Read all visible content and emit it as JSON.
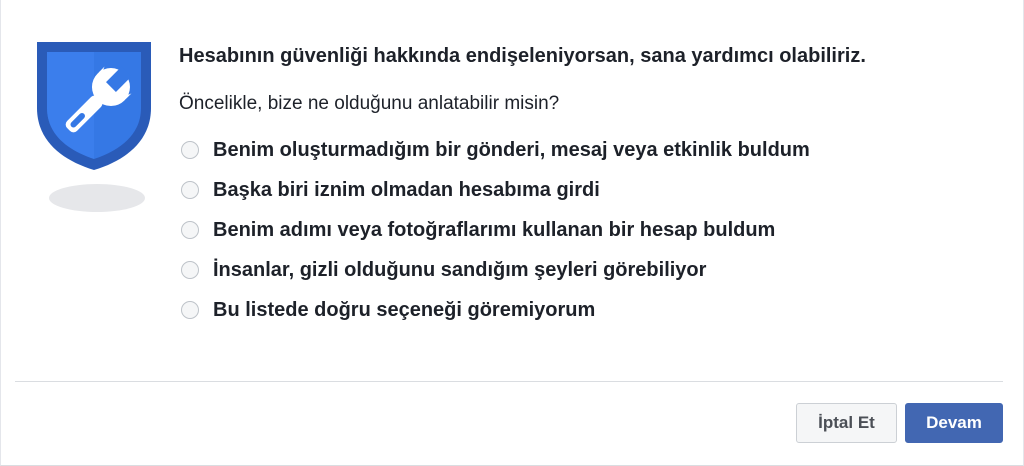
{
  "illustration": {
    "icon": "shield-wrench-icon",
    "shield_color": "#3578e5",
    "shield_border_color": "#2a5bb8"
  },
  "dialog": {
    "headline": "Hesabının güvenliği hakkında endişeleniyorsan, sana yardımcı olabiliriz.",
    "question": "Öncelikle, bize ne olduğunu anlatabilir misin?",
    "options": [
      {
        "label": "Benim oluşturmadığım bir gönderi, mesaj veya etkinlik buldum",
        "selected": false
      },
      {
        "label": "Başka biri iznim olmadan hesabıma girdi",
        "selected": false
      },
      {
        "label": "Benim adımı veya fotoğraflarımı kullanan bir hesap buldum",
        "selected": false
      },
      {
        "label": "İnsanlar, gizli olduğunu sandığım şeyleri görebiliyor",
        "selected": false
      },
      {
        "label": "Bu listede doğru seçeneği göremiyorum",
        "selected": false
      }
    ]
  },
  "footer": {
    "cancel_label": "İptal Et",
    "continue_label": "Devam"
  },
  "colors": {
    "primary_button": "#4267b2",
    "text": "#1d2129"
  }
}
